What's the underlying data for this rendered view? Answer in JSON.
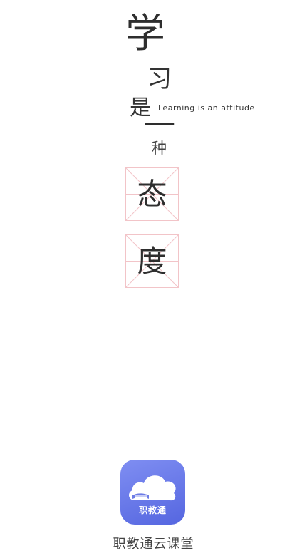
{
  "slogan": {
    "char_1": "学",
    "char_2": "习",
    "char_3": "是",
    "char_4": "一",
    "char_5": "种",
    "english": "Learning is an attitude",
    "grid_char_1": "态",
    "grid_char_2": "度"
  },
  "colors": {
    "grid_line": "#f2c4c8",
    "text": "#333333",
    "icon_gradient_start": "#7f8ef2",
    "icon_gradient_end": "#5566e0"
  },
  "app": {
    "icon_name": "cloud-book-icon",
    "icon_label": "职教通",
    "name": "职教通云课堂"
  }
}
